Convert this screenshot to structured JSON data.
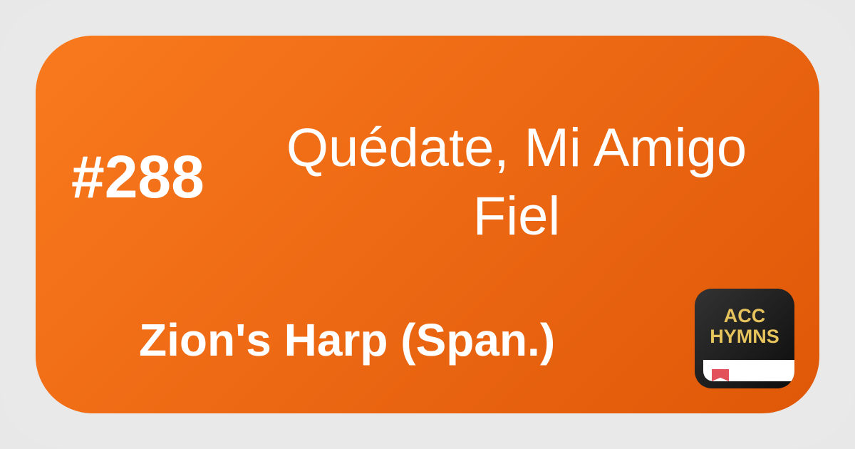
{
  "hymn": {
    "number": "#288",
    "title": "Quédate, Mi Amigo Fiel",
    "hymnal": "Zion's Harp (Span.)"
  },
  "logo": {
    "text": "ACC HYMNS",
    "icon": "book-icon"
  },
  "colors": {
    "card_start": "#f97a1e",
    "card_end": "#df5808",
    "logo_text": "#e6c35c",
    "bookmark": "#e2505a"
  }
}
